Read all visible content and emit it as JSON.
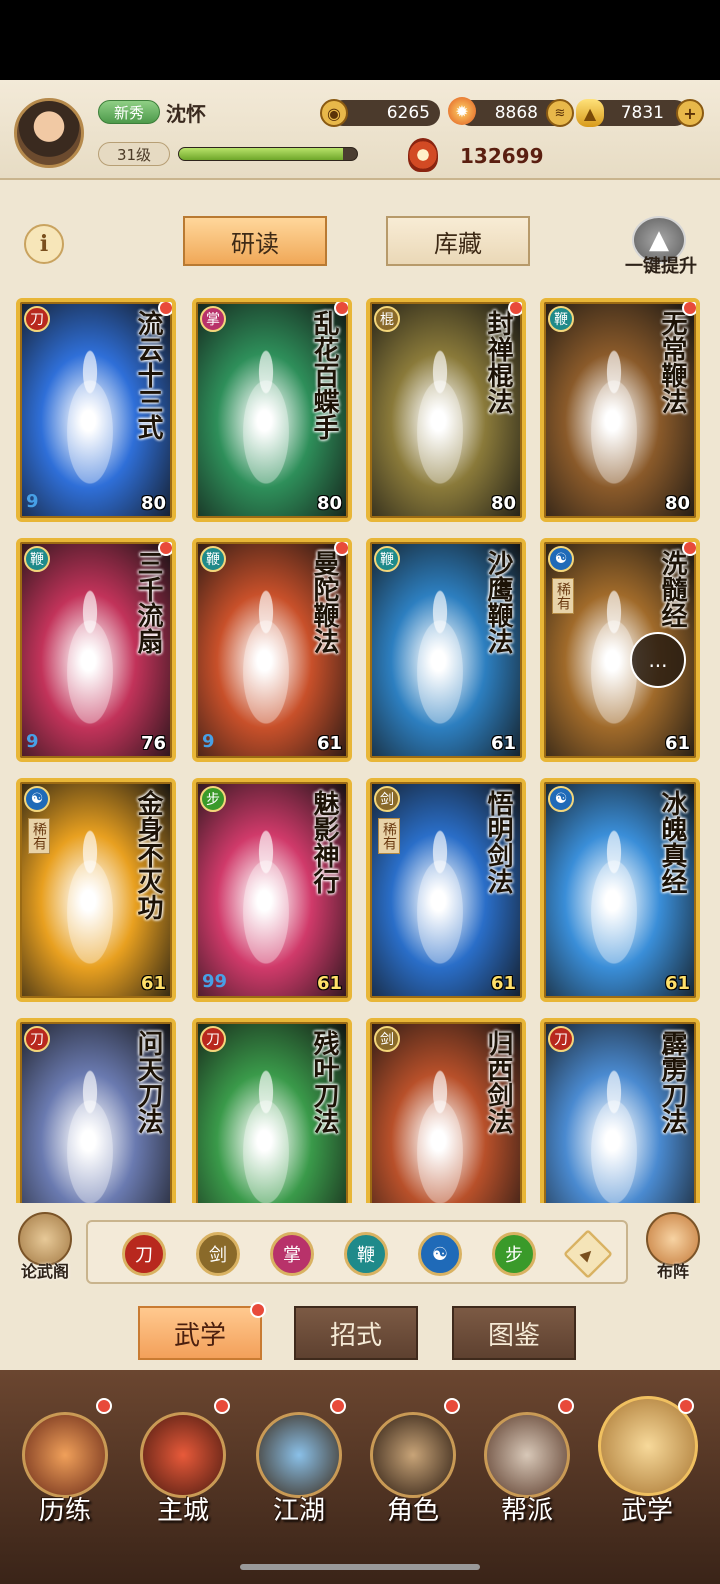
{
  "header": {
    "rank_badge": "新秀",
    "player_name": "沈怀",
    "level": "31级",
    "xp_progress": 0.92,
    "coins": "6265",
    "fire": "8868",
    "gold": "7831",
    "combat_power": "132699"
  },
  "controls": {
    "info_label": "i",
    "tab_study": "研读",
    "tab_storage": "库藏",
    "one_click_upgrade": "一键提升"
  },
  "cards": [
    {
      "name": "流云十三式",
      "level": "80",
      "school": "blade",
      "color": "#2f6fd8",
      "rare": "",
      "swirl": "9"
    },
    {
      "name": "乱花百蝶手",
      "level": "80",
      "school": "palm",
      "color": "#2e8f5a",
      "rare": "",
      "swirl": ""
    },
    {
      "name": "封禅棍法",
      "level": "80",
      "school": "staff",
      "color": "#8a7a3a",
      "rare": "",
      "swirl": ""
    },
    {
      "name": "无常鞭法",
      "level": "80",
      "school": "whip",
      "color": "#8a5a2a",
      "rare": "",
      "swirl": ""
    },
    {
      "name": "三千流扇",
      "level": "76",
      "school": "whip",
      "color": "#c2335a",
      "rare": "",
      "swirl": "9"
    },
    {
      "name": "曼陀鞭法",
      "level": "61",
      "school": "whip",
      "color": "#c8502a",
      "rare": "",
      "swirl": "9"
    },
    {
      "name": "沙鹰鞭法",
      "level": "61",
      "school": "whip",
      "color": "#2d7fc0",
      "rare": "",
      "swirl": ""
    },
    {
      "name": "洗髓经",
      "level": "61",
      "school": "taiji",
      "color": "#a06a2a",
      "rare": "稀有",
      "swirl": ""
    },
    {
      "name": "金身不灭功",
      "level": "61",
      "school": "taiji",
      "color": "#e8a020",
      "rare": "稀有",
      "swirl": ""
    },
    {
      "name": "魅影神行",
      "level": "61",
      "school": "swift",
      "color": "#d03a6a",
      "rare": "",
      "swirl": "99"
    },
    {
      "name": "悟明剑法",
      "level": "61",
      "school": "sword",
      "color": "#2a6ec8",
      "rare": "稀有",
      "swirl": ""
    },
    {
      "name": "冰魄真经",
      "level": "61",
      "school": "taiji",
      "color": "#3a8ed8",
      "rare": "",
      "swirl": ""
    },
    {
      "name": "问天刀法",
      "level": "",
      "school": "blade",
      "color": "#6a7ab0",
      "rare": "",
      "swirl": ""
    },
    {
      "name": "残叶刀法",
      "level": "",
      "school": "blade",
      "color": "#3a9a4a",
      "rare": "",
      "swirl": ""
    },
    {
      "name": "归西剑法",
      "level": "",
      "school": "sword",
      "color": "#b8502a",
      "rare": "",
      "swirl": ""
    },
    {
      "name": "霹雳刀法",
      "level": "",
      "school": "blade",
      "color": "#4a8ad0",
      "rare": "",
      "swirl": ""
    }
  ],
  "filter": {
    "left_label": "论武阁",
    "right_label": "布阵",
    "icons": [
      {
        "name": "blade-school-icon",
        "color": "#b8281e"
      },
      {
        "name": "sword-school-icon",
        "color": "#8a6a2a"
      },
      {
        "name": "palm-school-icon",
        "color": "#b8326a"
      },
      {
        "name": "whip-school-icon",
        "color": "#1f8a8a"
      },
      {
        "name": "taiji-school-icon",
        "color": "#1f6ab8"
      },
      {
        "name": "swift-school-icon",
        "color": "#3a9a2a"
      },
      {
        "name": "all-school-icon",
        "color": "#c9a35f"
      }
    ]
  },
  "lower_tabs": [
    "武学",
    "招式",
    "图鉴"
  ],
  "nav": [
    "历练",
    "主城",
    "江湖",
    "角色",
    "帮派",
    "武学"
  ],
  "chat_icon": "..."
}
